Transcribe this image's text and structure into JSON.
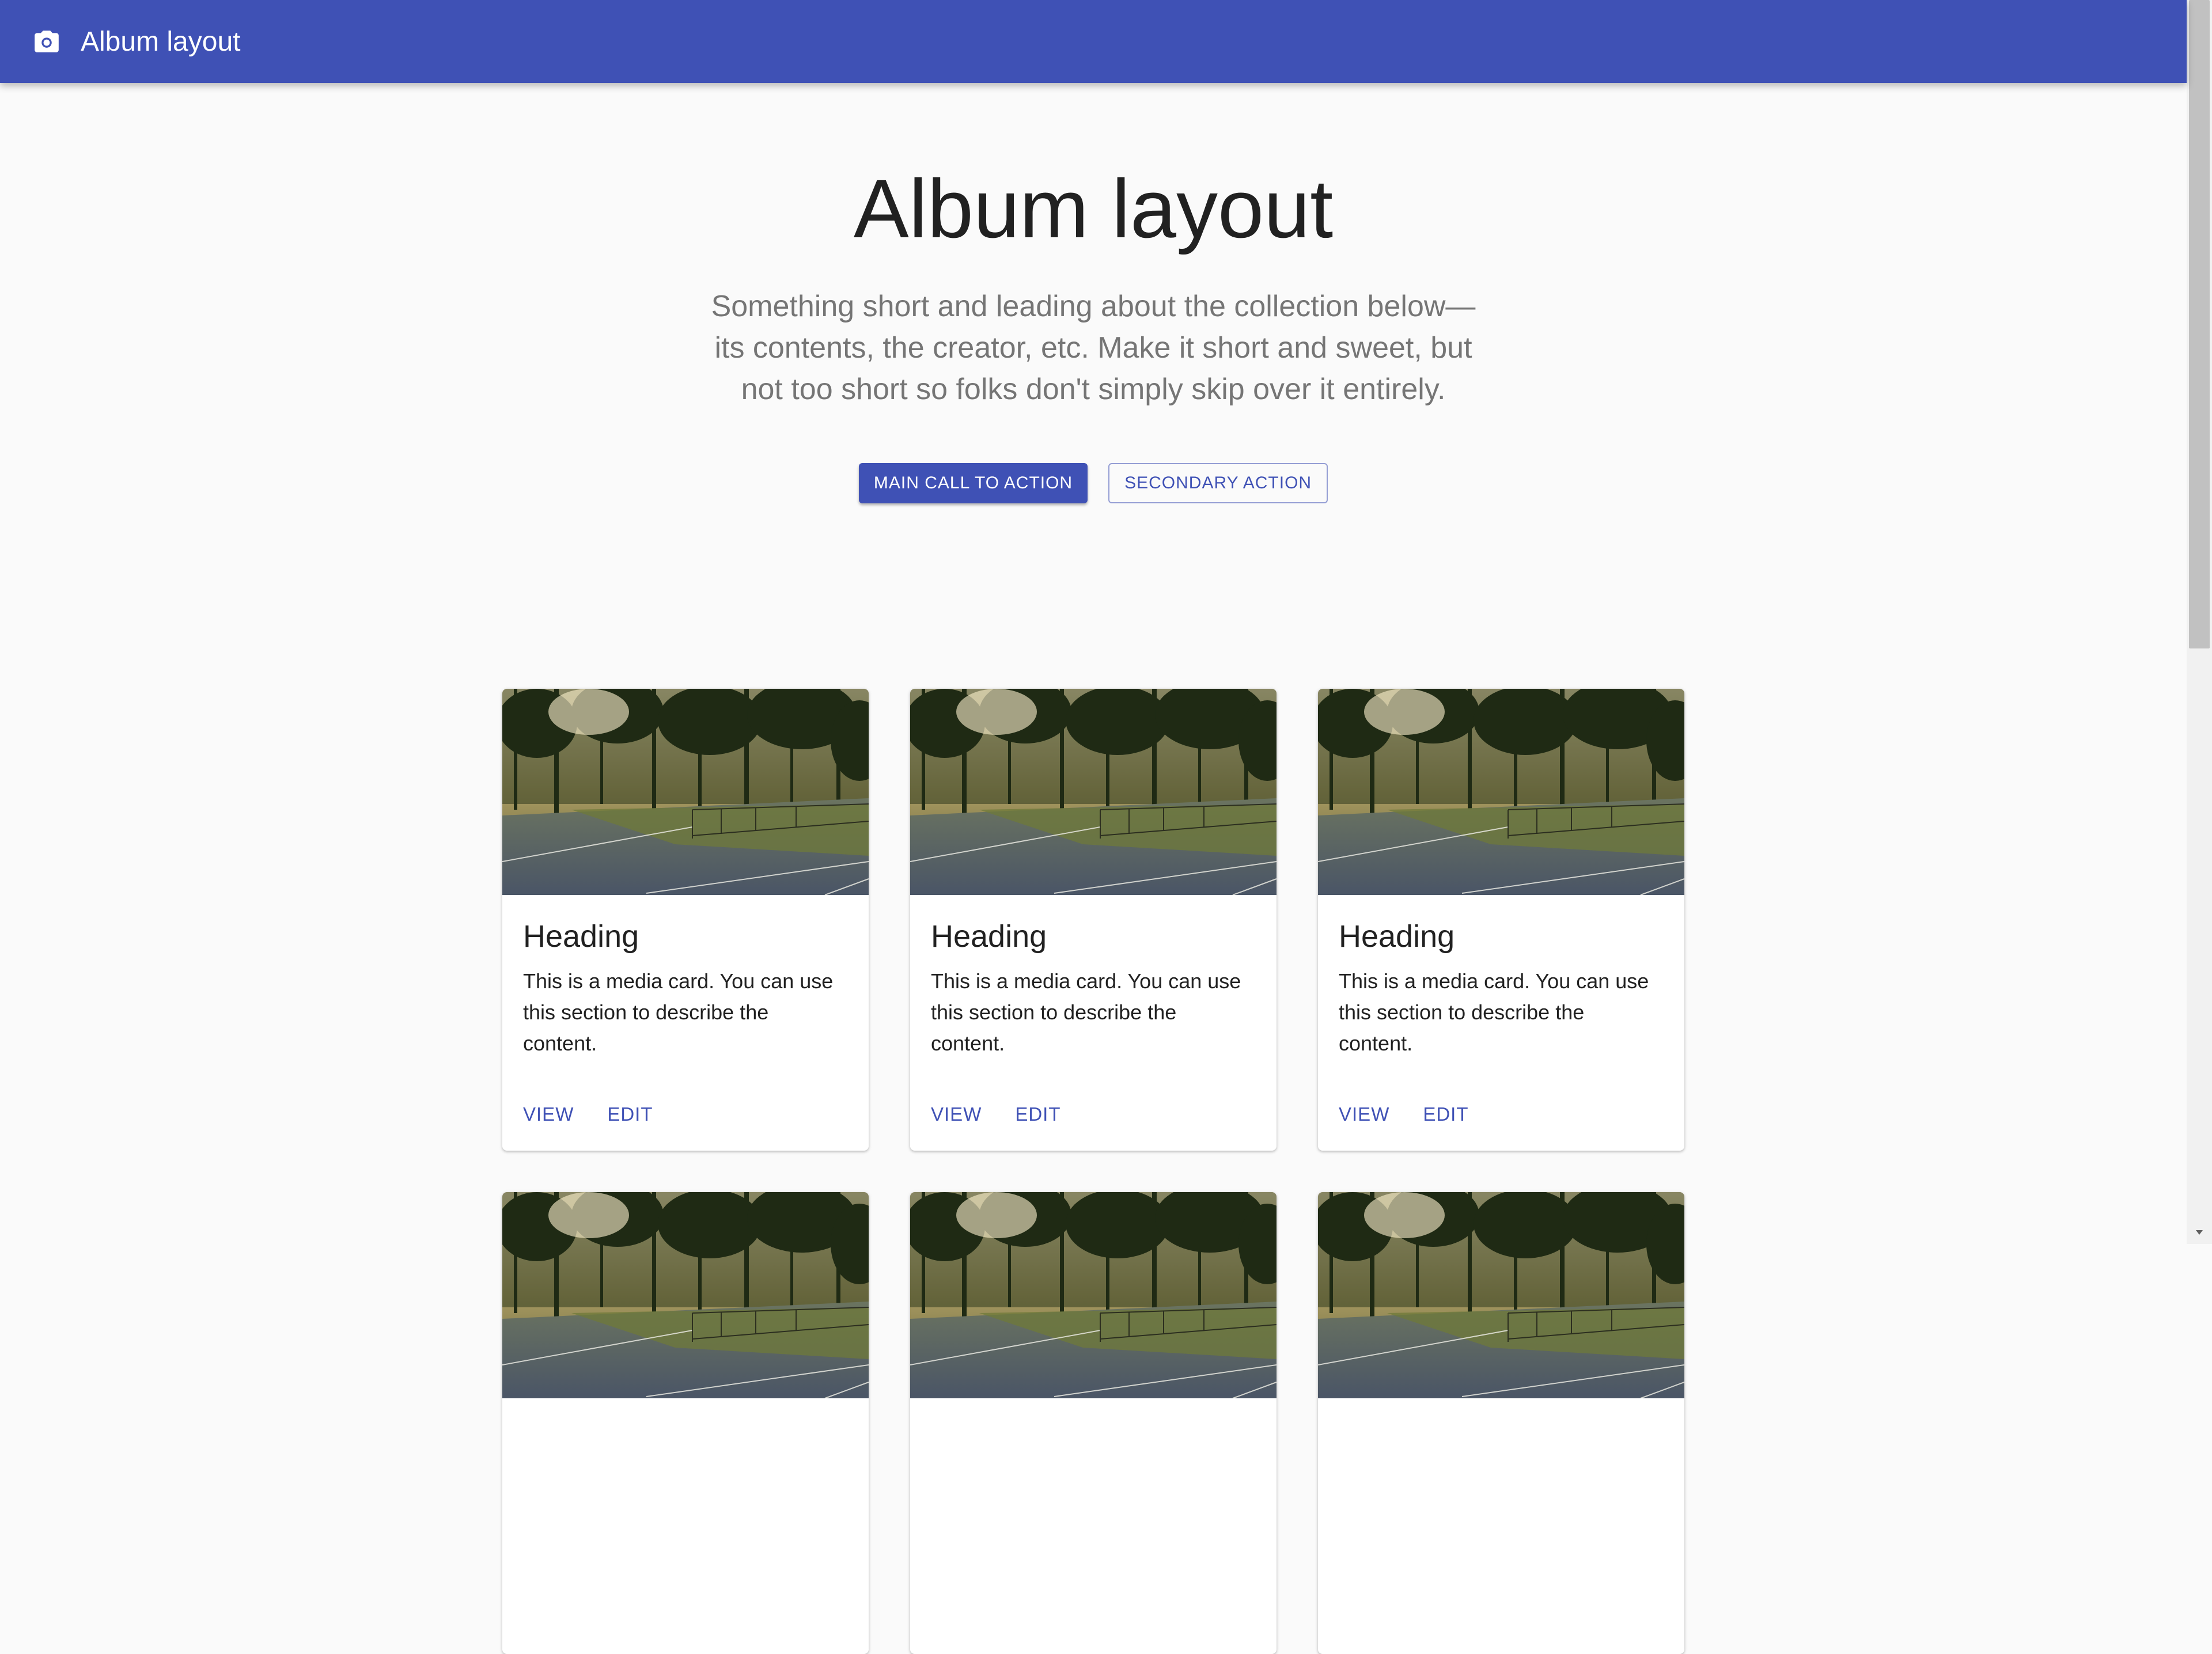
{
  "appbar": {
    "title": "Album layout",
    "icon": "camera-icon"
  },
  "hero": {
    "title": "Album layout",
    "description": "Something short and leading about the collection below—its contents, the creator, etc. Make it short and sweet, but not too short so folks don't simply skip over it entirely.",
    "primary_label": "Main call to action",
    "secondary_label": "Secondary action"
  },
  "cards": [
    {
      "heading": "Heading",
      "text": "This is a media card. You can use this section to describe the content.",
      "view_label": "View",
      "edit_label": "Edit"
    },
    {
      "heading": "Heading",
      "text": "This is a media card. You can use this section to describe the content.",
      "view_label": "View",
      "edit_label": "Edit"
    },
    {
      "heading": "Heading",
      "text": "This is a media card. You can use this section to describe the content.",
      "view_label": "View",
      "edit_label": "Edit"
    }
  ],
  "colors": {
    "primary": "#3f51b5",
    "background": "#fafafa",
    "text": "#212121",
    "muted": "#757575"
  }
}
